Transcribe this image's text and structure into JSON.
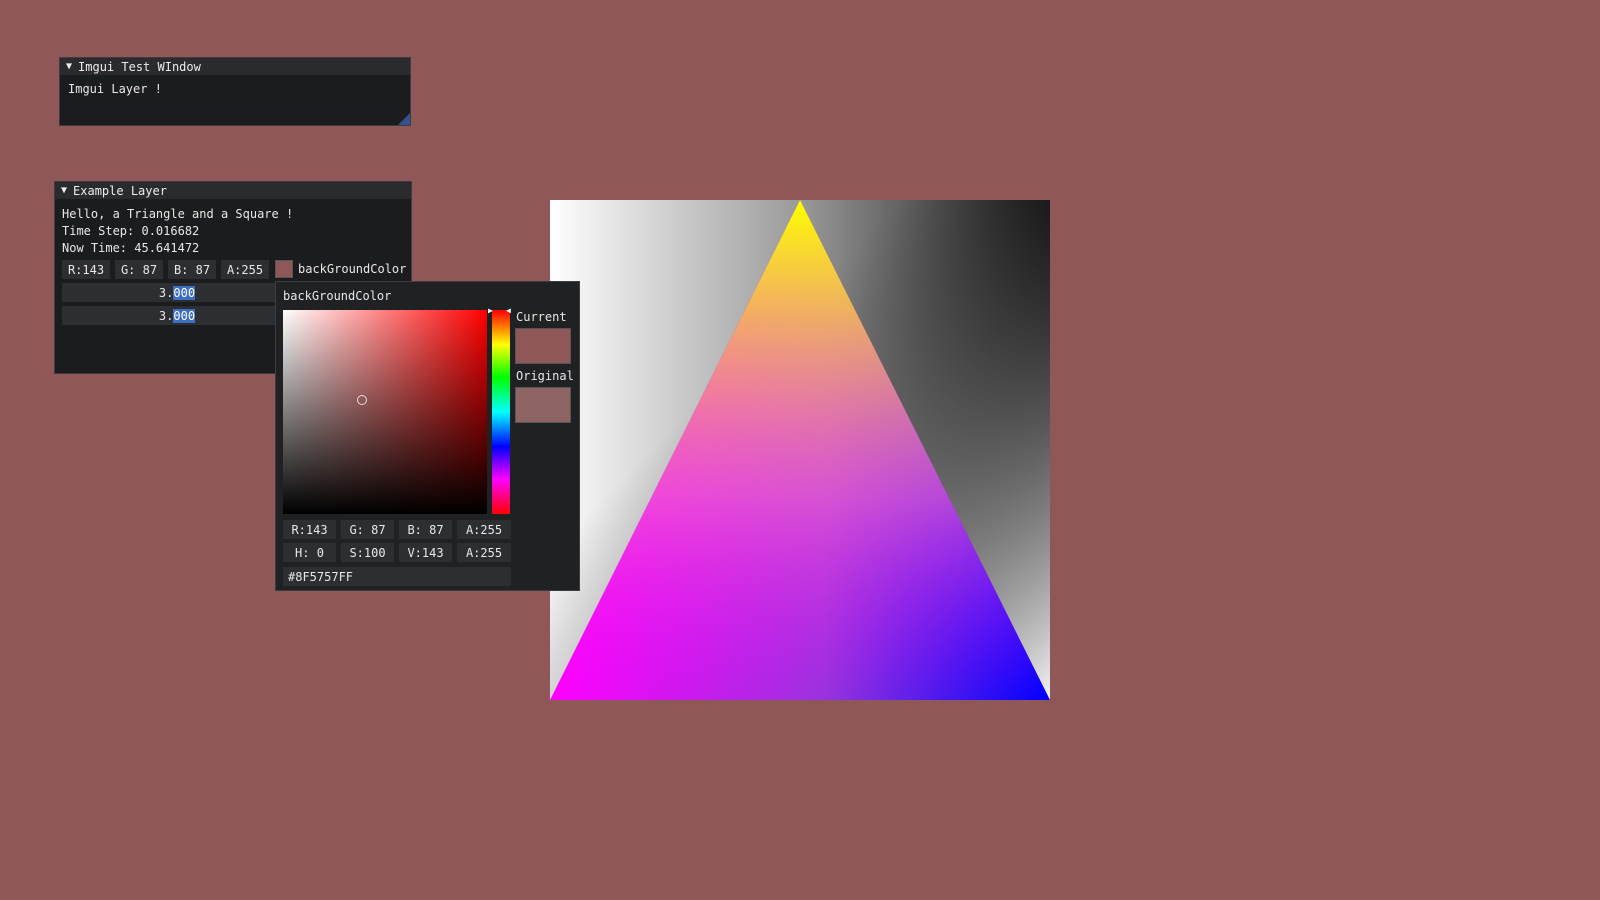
{
  "imgui_test_window": {
    "title": "Imgui Test WIndow",
    "text": "Imgui Layer !"
  },
  "example_layer": {
    "title": "Example Layer",
    "lines": [
      "Hello, a Triangle and a Square !",
      "Time Step: 0.016682",
      "Now Time: 45.641472"
    ],
    "color_fields": [
      "R:143",
      "G: 87",
      "B: 87",
      "A:255"
    ],
    "color_label": "backGroundColor",
    "slider1": {
      "pre": "3.",
      "sel": "000"
    },
    "slider2": {
      "pre": "3.",
      "sel": "000"
    }
  },
  "color_picker": {
    "title": "backGroundColor",
    "current_label": "Current",
    "original_label": "Original",
    "rgba_fields": [
      "R:143",
      "G: 87",
      "B: 87",
      "A:255"
    ],
    "hsva_fields": [
      "H:  0",
      "S:100",
      "V:143",
      "A:255"
    ],
    "hex": "#8F5757FF"
  },
  "colors": {
    "background": "#8f5757",
    "current": "#8f5757",
    "original": "#8f6464"
  }
}
